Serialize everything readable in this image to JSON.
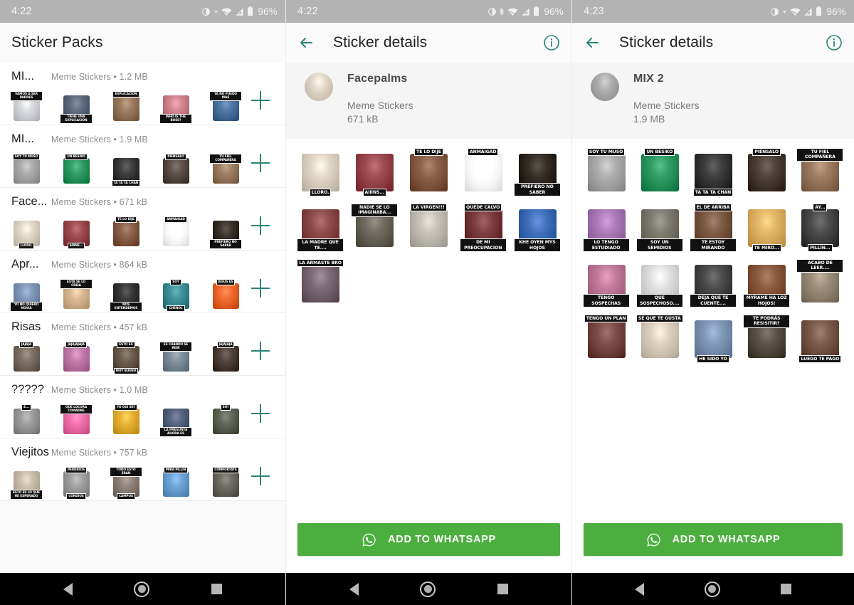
{
  "screens": [
    {
      "id": "sticker-packs-list",
      "statusbar": {
        "time": "4:22",
        "battery": "96%"
      },
      "appbar": {
        "title": "Sticker Packs"
      },
      "packs": [
        {
          "name": "MI...",
          "meta": "Meme Stickers • 1.2 MB",
          "stickers": [
            {
              "top": "VAMOS A SER PADRES",
              "bottom": "",
              "tone": "#c6c8cd"
            },
            {
              "top": "",
              "bottom": "TIENE UNA EXPLICACION",
              "tone": "#4d5a6e"
            },
            {
              "top": "EXPLICACION",
              "bottom": "",
              "tone": "#8a6a4e"
            },
            {
              "top": "",
              "bottom": "WHO IS THE BOSS?",
              "tone": "#c0727e"
            },
            {
              "top": "YA NO PUEDO MAS",
              "bottom": "",
              "tone": "#3d6490"
            }
          ]
        },
        {
          "name": "MI...",
          "meta": "Meme Stickers • 1.9 MB",
          "stickers": [
            {
              "top": "SOY TU MUSO",
              "bottom": "",
              "tone": "#9a9a9a"
            },
            {
              "top": "UN BESIKO",
              "bottom": "",
              "tone": "#1f8a52"
            },
            {
              "top": "",
              "bottom": "TA TA TA CHAN",
              "tone": "#2c2c2c"
            },
            {
              "top": "PIENSALO",
              "bottom": "",
              "tone": "#4a4038"
            },
            {
              "top": "TU FIEL COMPAÑERA",
              "bottom": "",
              "tone": "#8d6d52"
            }
          ]
        },
        {
          "name": "Face...",
          "meta": "Meme Stickers • 671 kB",
          "stickers": [
            {
              "top": "",
              "bottom": "LLORO.",
              "tone": "#cfc6b6"
            },
            {
              "top": "",
              "bottom": "AIIINS...",
              "tone": "#8b3a40"
            },
            {
              "top": "TE LO DIJE",
              "bottom": "",
              "tone": "#7a4f39"
            },
            {
              "top": "ANMAIGAD",
              "bottom": "",
              "tone": "#f2f2f2"
            },
            {
              "top": "",
              "bottom": "PREFIERO NO SABER",
              "tone": "#2a2118"
            }
          ]
        },
        {
          "name": "Apr...",
          "meta": "Meme Stickers • 864 kB",
          "stickers": [
            {
              "top": "",
              "bottom": "YO NO QUIERO NOVIA",
              "tone": "#6f86a6"
            },
            {
              "top": "ESTA SE LO CREIA",
              "bottom": "",
              "tone": "#c8a882"
            },
            {
              "top": "",
              "bottom": "NOS ENTENDEMOS",
              "tone": "#272727"
            },
            {
              "top": "SOY",
              "bottom": "CHENOL",
              "tone": "#2f7f86"
            },
            {
              "top": "JESUS ES",
              "bottom": "",
              "tone": "#df5a20"
            }
          ]
        },
        {
          "name": "Risas",
          "meta": "Meme Stickers • 457 kB",
          "stickers": [
            {
              "top": "JAJAJA",
              "bottom": "",
              "tone": "#6b5e52"
            },
            {
              "top": "JAJAJAJAJA",
              "bottom": "",
              "tone": "#b06a9a"
            },
            {
              "top": "ESTO ES",
              "bottom": "MUY BUENO",
              "tone": "#5a4b3c"
            },
            {
              "top": "ES CUANDO SE RIEN",
              "bottom": "",
              "tone": "#6e7d8a"
            },
            {
              "top": "JAJAJAJA",
              "bottom": "",
              "tone": "#3d3129"
            }
          ]
        },
        {
          "name": "?????",
          "meta": "Meme Stickers • 1.0 MB",
          "stickers": [
            {
              "top": "E...",
              "bottom": "",
              "tone": "#8a8a8a"
            },
            {
              "top": "QUE LOCURA COMADRE",
              "bottom": "",
              "tone": "#e0609b"
            },
            {
              "top": "YO QUI SE?",
              "bottom": "",
              "tone": "#d5a024"
            },
            {
              "top": "",
              "bottom": "LA PREGUNTA AHORA ES",
              "tone": "#44536b"
            },
            {
              "top": "EH?",
              "bottom": "",
              "tone": "#4f5544"
            }
          ]
        },
        {
          "name": "Viejitos",
          "meta": "Meme Stickers • 757 kB",
          "stickers": [
            {
              "top": "",
              "bottom": "ESTO ES LO QUE HE ESPERADO",
              "tone": "#b9ad99"
            },
            {
              "top": "PERDIDOS",
              "bottom": "CONDIOS",
              "tone": "#8e8e8e"
            },
            {
              "top": "TODO ESTO ERAN",
              "bottom": "CAMPOS",
              "tone": "#7e7268"
            },
            {
              "top": "MIRA PILLIN",
              "bottom": "",
              "tone": "#5d92c4"
            },
            {
              "top": "COMPORTATE",
              "bottom": "",
              "tone": "#5c5a52"
            }
          ]
        }
      ],
      "add_icon": "plus-icon",
      "navbar": {
        "back": "back-icon",
        "home": "home-icon",
        "recents": "recents-icon"
      }
    },
    {
      "id": "sticker-details-facepalms",
      "statusbar": {
        "time": "4:22",
        "battery": "96%"
      },
      "appbar": {
        "title": "Sticker details",
        "back_icon": "arrow-left-icon",
        "info_icon": "info-icon"
      },
      "detail": {
        "title": "Facepalms",
        "publisher": "Meme Stickers",
        "size": "671 kB"
      },
      "stickers": [
        {
          "top": "",
          "bottom": "LLORO.",
          "tone": "#cfc6b6"
        },
        {
          "top": "",
          "bottom": "AIIINS...",
          "tone": "#8b3a40"
        },
        {
          "top": "TE LO DIJE",
          "bottom": "",
          "tone": "#7a4f39"
        },
        {
          "top": "ANMAIGAD",
          "bottom": "",
          "tone": "#f4f4f4"
        },
        {
          "top": "",
          "bottom": "PREFIERO NO SABER",
          "tone": "#241d16"
        },
        {
          "top": "",
          "bottom": "LA MADRE QUE TE....",
          "tone": "#7c3b38"
        },
        {
          "top": "NADIE SE LO IMAGINABA...",
          "bottom": "",
          "tone": "#5f5a4e"
        },
        {
          "top": "LA VIRGEN!!!",
          "bottom": "",
          "tone": "#b4b0a8"
        },
        {
          "top": "QUEDE CALVO",
          "bottom": "DE MI PREOCUPACION",
          "tone": "#6a2c2c"
        },
        {
          "top": "",
          "bottom": "KHE OYEN MYS HOJOS",
          "tone": "#2f5fa8"
        },
        {
          "top": "LA ARMASTE BRO",
          "bottom": "",
          "tone": "#6b5a66"
        }
      ],
      "cta": {
        "label": "ADD TO WHATSAPP",
        "icon": "whatsapp-icon",
        "color": "#4cae3f"
      },
      "navbar": {
        "back": "back-icon",
        "home": "home-icon",
        "recents": "recents-icon"
      }
    },
    {
      "id": "sticker-details-mix2",
      "statusbar": {
        "time": "4:23",
        "battery": "96%"
      },
      "appbar": {
        "title": "Sticker details",
        "back_icon": "arrow-left-icon",
        "info_icon": "info-icon"
      },
      "detail": {
        "title": "MIX 2",
        "publisher": "Meme Stickers",
        "size": "1.9 MB"
      },
      "stickers": [
        {
          "top": "SOY TU MUSO",
          "bottom": "",
          "tone": "#9c9c9c"
        },
        {
          "top": "UN BESIKO",
          "bottom": "",
          "tone": "#1f8a52"
        },
        {
          "top": "",
          "bottom": "TA TA TA CHAN",
          "tone": "#2b2b2b"
        },
        {
          "top": "PIÉNSALO",
          "bottom": "",
          "tone": "#3c3128"
        },
        {
          "top": "TU FIEL COMPAÑERA",
          "bottom": "",
          "tone": "#8a6a50"
        },
        {
          "top": "",
          "bottom": "LO TENGO ESTUDIADO",
          "tone": "#9a6aa8"
        },
        {
          "top": "",
          "bottom": "SOY UN SEMIDIOS",
          "tone": "#6d6a60"
        },
        {
          "top": "EL DE ARRIBA",
          "bottom": "TE ESTOY MIRANDO",
          "tone": "#6b4a34"
        },
        {
          "top": "",
          "bottom": "TE MIRO...",
          "tone": "#d2a456"
        },
        {
          "top": "AY...",
          "bottom": "PILLÍN...",
          "tone": "#3a3a3a"
        },
        {
          "top": "",
          "bottom": "TENGO SOSPECHAS",
          "tone": "#b06a8a"
        },
        {
          "top": "",
          "bottom": "QUE SOSPECHOSO....",
          "tone": "#cfcfcf"
        },
        {
          "top": "",
          "bottom": "DEJA QUE TE CUENTE....",
          "tone": "#3a3a3a"
        },
        {
          "top": "",
          "bottom": "MYRAME HA LOZ HOJOS!",
          "tone": "#7a4a2e"
        },
        {
          "top": "ACABO DE LEER....",
          "bottom": "",
          "tone": "#8a7a68"
        },
        {
          "top": "TENGO UN PLAN",
          "bottom": "",
          "tone": "#6b3c38"
        },
        {
          "top": "SÉ QUE TE GUSTA",
          "bottom": "",
          "tone": "#cbc0ae"
        },
        {
          "top": "",
          "bottom": "HE SIDO YO",
          "tone": "#6f86a6"
        },
        {
          "top": "TE PODRÁS RESISITIR?",
          "bottom": "",
          "tone": "#4a4238"
        },
        {
          "top": "",
          "bottom": "LUEGO TE PAGO",
          "tone": "#6a4a3a"
        }
      ],
      "cta": {
        "label": "ADD TO WHATSAPP",
        "icon": "whatsapp-icon",
        "color": "#4cae3f"
      },
      "navbar": {
        "back": "back-icon",
        "home": "home-icon",
        "recents": "recents-icon"
      }
    }
  ],
  "theme": {
    "accent": "#2b8478",
    "whatsapp_green": "#4cae3f",
    "statusbar": "#b3b3b3"
  }
}
